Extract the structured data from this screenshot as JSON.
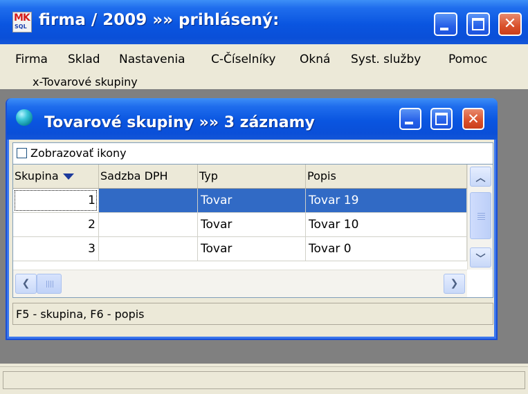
{
  "app": {
    "logo_text_top": "MK",
    "logo_text_bottom": "SQL",
    "title": "firma / 2009 »» prihlásený:"
  },
  "menu": {
    "items": [
      "Firma",
      "Sklad",
      "Nastavenia",
      "C-Číselníky",
      "Okná",
      "Syst. služby",
      "Pomoc"
    ],
    "second_row": [
      "x-Tovarové skupiny"
    ]
  },
  "child_window": {
    "title": "Tovarové skupiny »» 3 záznamy",
    "show_icons_label": "Zobrazovať ikony",
    "show_icons_checked": false,
    "columns": [
      "Skupina",
      "Sadzba DPH",
      "Typ",
      "Popis"
    ],
    "sort_column": "Skupina",
    "sort_direction": "descending-indicator",
    "rows": [
      {
        "skupina": "1",
        "sadzba": "",
        "typ": "Tovar",
        "popis": "Tovar 19",
        "selected": true
      },
      {
        "skupina": "2",
        "sadzba": "",
        "typ": "Tovar",
        "popis": "Tovar 10",
        "selected": false
      },
      {
        "skupina": "3",
        "sadzba": "",
        "typ": "Tovar",
        "popis": "Tovar 0",
        "selected": false
      }
    ],
    "status": "F5 - skupina, F6 - popis"
  },
  "colors": {
    "titlebar": "#0a55e0",
    "selection": "#316ac5",
    "close_button": "#d9502b",
    "mdi_background": "#808080"
  }
}
